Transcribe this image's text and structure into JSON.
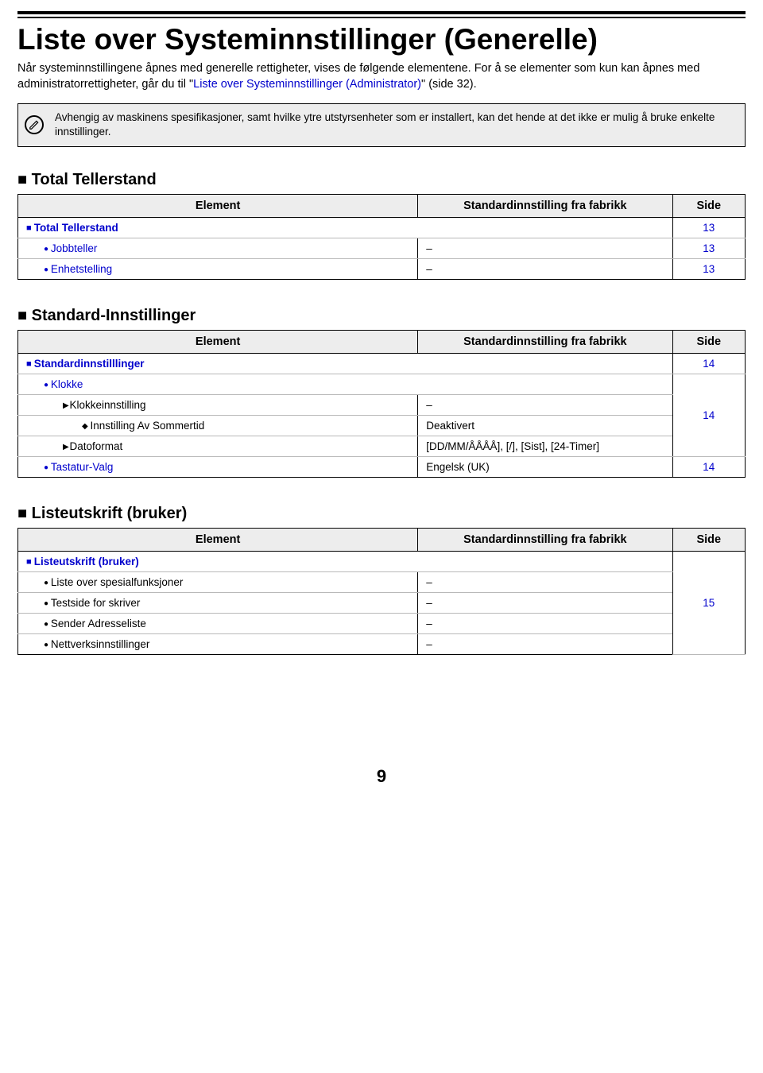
{
  "title": "Liste over Systeminnstillinger (Generelle)",
  "intro_plain1": "Når systeminnstillingene åpnes med generelle rettigheter, vises de følgende elementene. For å se elementer som kun kan åpnes med administratorrettigheter, går du til \"",
  "intro_link": "Liste over Systeminnstillinger (Administrator)",
  "intro_plain2": "\" (side 32).",
  "note": "Avhengig av maskinens spesifikasjoner, samt hvilke ytre utstyrsenheter som er installert, kan det hende at det ikke er mulig å bruke enkelte innstillinger.",
  "headers": {
    "element": "Element",
    "std": "Standardinnstilling fra fabrikk",
    "side": "Side"
  },
  "sections": [
    {
      "title": "Total Tellerstand",
      "rows": [
        {
          "level": 0,
          "bullet": "sq",
          "label": "Total Tellerstand",
          "link": true,
          "std": null,
          "side": "13",
          "side_rowspan": 1,
          "span_el_std": true
        },
        {
          "level": 1,
          "bullet": "circ",
          "label": "Jobbteller",
          "link": true,
          "std": "–",
          "side": "13",
          "side_rowspan": 1
        },
        {
          "level": 1,
          "bullet": "circ",
          "label": "Enhetstelling",
          "link": true,
          "std": "–",
          "side": "13",
          "side_rowspan": 1,
          "last": true
        }
      ]
    },
    {
      "title": "Standard-Innstillinger",
      "rows": [
        {
          "level": 0,
          "bullet": "sq",
          "label": "Standardinnstilllinger",
          "link": true,
          "std": null,
          "side": "14",
          "side_rowspan": 1,
          "span_el_std": true
        },
        {
          "level": 1,
          "bullet": "circ",
          "label": "Klokke",
          "link": true,
          "std": null,
          "side": "14",
          "side_rowspan": 4,
          "span_el_std": true
        },
        {
          "level": 2,
          "bullet": "tri",
          "label": "Klokkeinnstilling",
          "link": false,
          "std": "–",
          "skip_side": true
        },
        {
          "level": 3,
          "bullet": "dia",
          "label": "Innstilling Av Sommertid",
          "link": false,
          "std": "Deaktivert",
          "skip_side": true
        },
        {
          "level": 2,
          "bullet": "tri",
          "label": "Datoformat",
          "link": false,
          "std": "[DD/MM/ÅÅÅÅ], [/], [Sist], [24-Timer]",
          "skip_side": true
        },
        {
          "level": 1,
          "bullet": "circ",
          "label": "Tastatur-Valg",
          "link": true,
          "std": "Engelsk (UK)",
          "side": "14",
          "side_rowspan": 1,
          "last": true
        }
      ]
    },
    {
      "title": "Listeutskrift (bruker)",
      "rows": [
        {
          "level": 0,
          "bullet": "sq",
          "label": "Listeutskrift (bruker)",
          "link": true,
          "std": null,
          "side": "15",
          "side_rowspan": 5,
          "span_el_std": true
        },
        {
          "level": 1,
          "bullet": "circ",
          "label": "Liste over spesialfunksjoner",
          "link": false,
          "std": "–",
          "skip_side": true
        },
        {
          "level": 1,
          "bullet": "circ",
          "label": "Testside for skriver",
          "link": false,
          "std": "–",
          "skip_side": true
        },
        {
          "level": 1,
          "bullet": "circ",
          "label": "Sender Adresseliste",
          "link": false,
          "std": "–",
          "skip_side": true
        },
        {
          "level": 1,
          "bullet": "circ",
          "label": "Nettverksinnstillinger",
          "link": false,
          "std": "–",
          "skip_side": true,
          "last": true
        }
      ]
    }
  ],
  "page_number": "9"
}
